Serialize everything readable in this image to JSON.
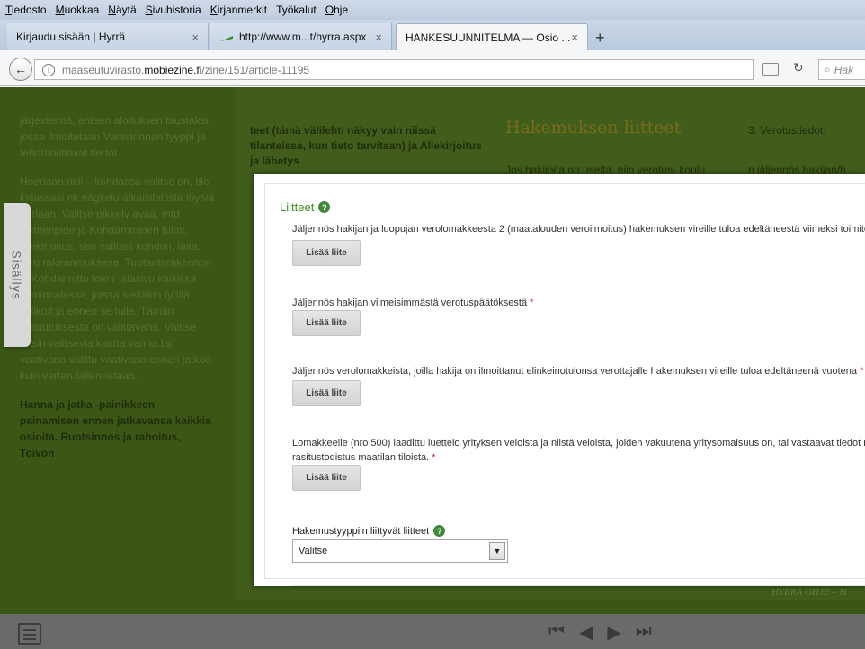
{
  "menubar": {
    "items": [
      {
        "accel": "T",
        "rest": "iedosto"
      },
      {
        "accel": "M",
        "rest": "uokkaa"
      },
      {
        "accel": "N",
        "rest": "äytä"
      },
      {
        "accel": "S",
        "rest": "ivuhistoria"
      },
      {
        "accel": "K",
        "rest": "irjanmerkit"
      },
      {
        "accel": "",
        "rest": "Työkalut"
      },
      {
        "accel": "O",
        "rest": "hje"
      }
    ]
  },
  "tabs": [
    {
      "label": "Kirjaudu sisään | Hyrrä",
      "close": "×"
    },
    {
      "label": "http://www.m...t/hyrra.aspx",
      "close": "×"
    },
    {
      "label": "HANKESUUNNITELMA — Osio ...",
      "close": "×"
    }
  ],
  "new_tab_label": "+",
  "url": {
    "prefix": "maaseutuvirasto.",
    "domain": "mobiezine.fi",
    "path": "/zine/151/article-11195"
  },
  "search_placeholder": "Hak",
  "background": {
    "left_paragraphs": [
      "järjestelmä, antaen aloituksen taustaksi, jossa ilmoitetaan Varavirinnan tyyppi ja tehotarvittavat tiedot.",
      "Hoeriaan rikli – kohdassa valitse on, tile kirjassasi nk nägkelu alkaisilatlista löytvä aariaan. Valitse pikkelv avaa, mtd Toimenpide ja Kohdamminen tulmi, allekirjoitus, sen valitset kohdan, laita. Neu rakeanmuksesa, Tuotantorakennon ja Kohdannittu toimi -alasivu kaikissa toiminnalassa, joissa sieltäkin työllä valikoit ja ennen se tulle. Tämän valtuutuksesta on valittavana. Valitse ensin valitsevia kautta vanha tai vaativana valittu vaativana ennen jatkoa kuin varten tallennetaan.",
      "Hanna ja jatka -painikkeen painamisen ennen jatkavansa kaikkia osioita. Ruotsinnos ja rahoitus, Toivon"
    ],
    "main_snippet": "teet (tämä välilehti näkyy vain niissä tilanteissa, kun tieto tarvitaan) ja Allekirjoitus ja lähetys",
    "main_title": "Hakemuksen liitteet",
    "main_snippet2": "Jos hakijoita on useita, niin verotus- koulu",
    "right_snippet": "3. Verotustiedot:",
    "right_snippet2": "n jäljennös hakijan/h",
    "footer_label": "HYRRÄ OHJE – H",
    "side_tab_label": "Sisällys"
  },
  "modal": {
    "title": "Liitteet",
    "help_glyph": "?",
    "attachments": [
      {
        "label": "Jäljennös hakijan ja luopujan verolomakkeesta 2 (maatalouden veroilmoitus) hakemuksen vireille tuloa edeltäneestä viimeksi toimitetusta v",
        "required": "",
        "button": "Lisää liite"
      },
      {
        "label": "Jäljennös hakijan viimeisimmästä verotuspäätöksestä",
        "required": "*",
        "button": "Lisää liite"
      },
      {
        "label": "Jäljennös verolomakkeista, joilla hakija on ilmoittanut elinkeinotulonsa verottajalle hakemuksen vireille tuloa edeltäneenä vuotena",
        "required": "*",
        "button": "Lisää liite"
      },
      {
        "label": "Lomakkeelle (nro 500) laadittu luettelo yrityksen veloista ja niistä veloista, joiden vakuutena yritysomaisuus on, tai vastaavat tiedot muute",
        "label2": "rasitustodistus maatilan tiloista.",
        "required": "*",
        "button": "Lisää liite"
      }
    ],
    "type_label": "Hakemustyyppiin liittyvät liitteet",
    "type_select_value": "Valitse",
    "select_arrow": "▼"
  },
  "colors": {
    "accent_green": "#3f8b23",
    "required_red": "#c03030",
    "overlay_green": "#3c5a18"
  }
}
